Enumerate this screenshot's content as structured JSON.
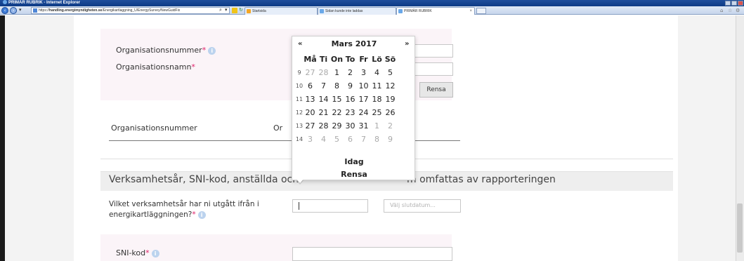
{
  "browser": {
    "window_title": "PRIMÄR RUBRIK - Internet Explorer",
    "address": {
      "prefix": "https://",
      "domain": "handling.energimyndigheten.se",
      "path": "/Energikartlaggning_U/EnergySurvey/NewGuidFix"
    },
    "address_search_icon": "⌕",
    "address_dropdown_icon": "▾",
    "tabs": [
      {
        "label": "Startsida",
        "icon_color": "#f5a623"
      },
      {
        "label": "Sidan kunde inte laddas",
        "icon_color": "#6aa8e8"
      },
      {
        "label": "PRIMÄR RUBRIK",
        "icon_color": "#6aa8e8",
        "close": "×"
      }
    ],
    "toolbar_icons": [
      "home-icon",
      "star-icon",
      "gear-icon"
    ]
  },
  "form": {
    "org_number_label": "Organisationsnummer",
    "org_name_label": "Organisationsnamn",
    "required_mark": "*",
    "info_glyph": "i",
    "clear_button": "Rensa",
    "table_col1": "Organisationsnummer",
    "table_col2": "Or",
    "section_title_part1": "Verksamhetsår, SNI-kod, anställda och",
    "section_title_part2": "m omfattas av rapporteringen",
    "period_label_line1": "Vilket verksamhetsår har ni utgått ifrån i",
    "period_label_line2": "energikartläggningen?",
    "start_date_value": "",
    "end_date_placeholder": "Välj slutdatum...",
    "sni_label": "SNI-kod"
  },
  "datepicker": {
    "prev": "«",
    "next": "»",
    "title": "Mars 2017",
    "weekdays": [
      "Må",
      "Ti",
      "On",
      "To",
      "Fr",
      "Lö",
      "Sö"
    ],
    "weeks": [
      {
        "wk": "9",
        "days": [
          [
            "27",
            true
          ],
          [
            "28",
            true
          ],
          [
            "1",
            false
          ],
          [
            "2",
            false
          ],
          [
            "3",
            false
          ],
          [
            "4",
            false
          ],
          [
            "5",
            false
          ]
        ]
      },
      {
        "wk": "10",
        "days": [
          [
            "6",
            false
          ],
          [
            "7",
            false
          ],
          [
            "8",
            false
          ],
          [
            "9",
            false
          ],
          [
            "10",
            false
          ],
          [
            "11",
            false
          ],
          [
            "12",
            false
          ]
        ]
      },
      {
        "wk": "11",
        "days": [
          [
            "13",
            false
          ],
          [
            "14",
            false
          ],
          [
            "15",
            false
          ],
          [
            "16",
            false
          ],
          [
            "17",
            false
          ],
          [
            "18",
            false
          ],
          [
            "19",
            false
          ]
        ]
      },
      {
        "wk": "12",
        "days": [
          [
            "20",
            false
          ],
          [
            "21",
            false
          ],
          [
            "22",
            false
          ],
          [
            "23",
            false
          ],
          [
            "24",
            false
          ],
          [
            "25",
            false
          ],
          [
            "26",
            false
          ]
        ]
      },
      {
        "wk": "13",
        "days": [
          [
            "27",
            false
          ],
          [
            "28",
            false
          ],
          [
            "29",
            false
          ],
          [
            "30",
            false
          ],
          [
            "31",
            false
          ],
          [
            "1",
            true
          ],
          [
            "2",
            true
          ]
        ]
      },
      {
        "wk": "14",
        "days": [
          [
            "3",
            true
          ],
          [
            "4",
            true
          ],
          [
            "5",
            true
          ],
          [
            "6",
            true
          ],
          [
            "7",
            true
          ],
          [
            "8",
            true
          ],
          [
            "9",
            true
          ]
        ]
      }
    ],
    "today": "Idag",
    "clear": "Rensa"
  },
  "colors": {
    "required": "#e0216a",
    "info_icon": "#bcd3ee",
    "card_bg": "#fbf4f8"
  }
}
